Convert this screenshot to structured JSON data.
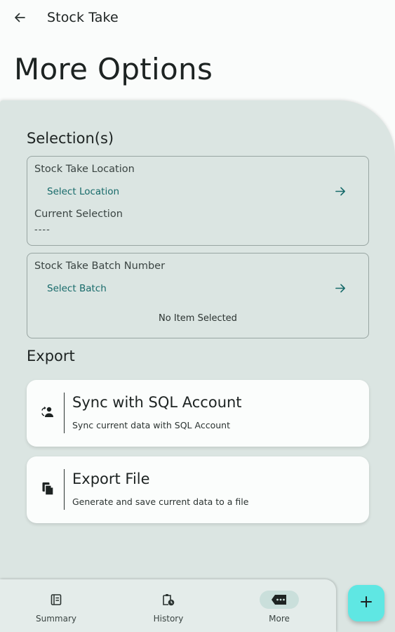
{
  "topbar": {
    "title": "Stock Take",
    "back_icon": "arrow-left-icon"
  },
  "page_title": "More Options",
  "selections": {
    "section_title": "Selection(s)",
    "location": {
      "label": "Stock Take Location",
      "action": "Select Location",
      "current_label": "Current Selection",
      "current_value": "----"
    },
    "batch": {
      "label": "Stock Take Batch Number",
      "action": "Select Batch",
      "status": "No Item Selected"
    }
  },
  "export": {
    "section_title": "Export",
    "items": [
      {
        "title": "Sync with SQL Account",
        "subtitle": "Sync current data with SQL Account",
        "icon": "sync-account-icon"
      },
      {
        "title": "Export File",
        "subtitle": "Generate and save current data to a file",
        "icon": "file-copy-icon"
      }
    ]
  },
  "bottom_nav": {
    "items": [
      {
        "label": "Summary",
        "icon": "summary-icon",
        "active": false
      },
      {
        "label": "History",
        "icon": "history-icon",
        "active": false
      },
      {
        "label": "More",
        "icon": "more-icon",
        "active": true
      }
    ]
  },
  "fab": {
    "icon": "plus-icon"
  },
  "colors": {
    "panel_bg": "#dbe5e2",
    "accent_text": "#176a6a",
    "fab_bg": "#5fe7e3",
    "nav_active_pill": "#cadfdb"
  }
}
